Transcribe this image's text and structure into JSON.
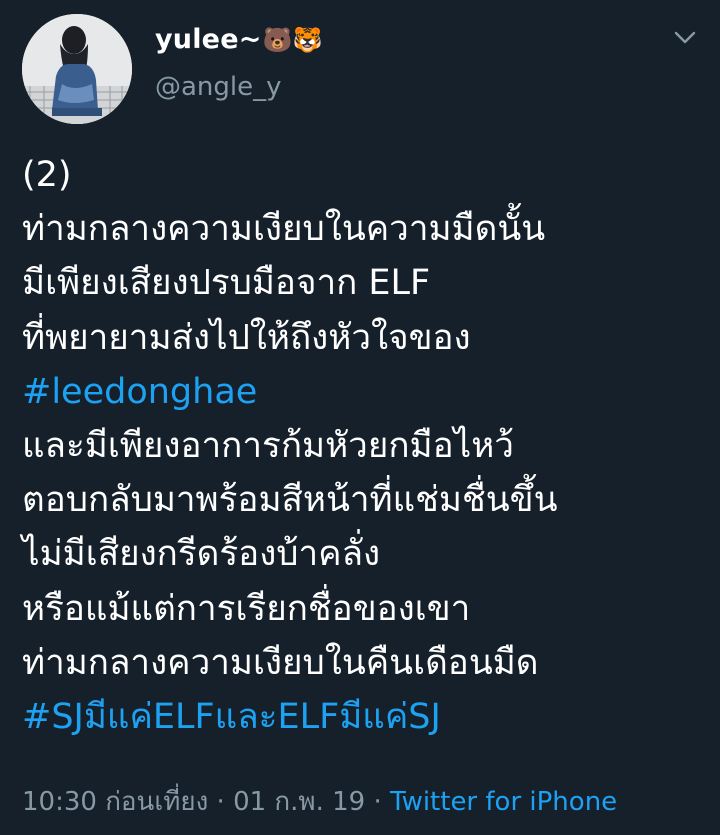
{
  "user": {
    "display_name": "yulee~",
    "name_emoji": "🐻🐯",
    "handle": "@angle_y"
  },
  "tweet": {
    "lines": [
      {
        "text": "(2)",
        "is_hashtag": false
      },
      {
        "text": "ท่ามกลางความเงียบในความมืดนั้น",
        "is_hashtag": false
      },
      {
        "text": "มีเพียงเสียงปรบมือจาก ELF",
        "is_hashtag": false
      },
      {
        "text": "ที่พยายามส่งไปให้ถึงหัวใจของ",
        "is_hashtag": false
      },
      {
        "text": "#leedonghae",
        "is_hashtag": true
      },
      {
        "text": "และมีเพียงอาการก้มหัวยกมือไหว้",
        "is_hashtag": false
      },
      {
        "text": "ตอบกลับมาพร้อมสีหน้าที่แช่มชื่นขึ้น",
        "is_hashtag": false
      },
      {
        "text": "ไม่มีเสียงกรีดร้องบ้าคลั่ง",
        "is_hashtag": false
      },
      {
        "text": "หรือแม้แต่การเรียกชื่อของเขา",
        "is_hashtag": false
      },
      {
        "text": "ท่ามกลางความเงียบในคืนเดือนมืด",
        "is_hashtag": false
      },
      {
        "text": "#SJมีแค่ELFและELFมีแค่SJ",
        "is_hashtag": true
      }
    ]
  },
  "meta": {
    "time": "10:30 ก่อนเที่ยง",
    "separator": " · ",
    "date": "01 ก.พ. 19",
    "source": "Twitter for iPhone"
  },
  "icons": {
    "caret": "chevron-down-icon",
    "avatar": "profile-photo"
  },
  "colors": {
    "background": "#15202b",
    "text": "#ffffff",
    "secondary": "#8899a6",
    "accent": "#1da1f2"
  }
}
